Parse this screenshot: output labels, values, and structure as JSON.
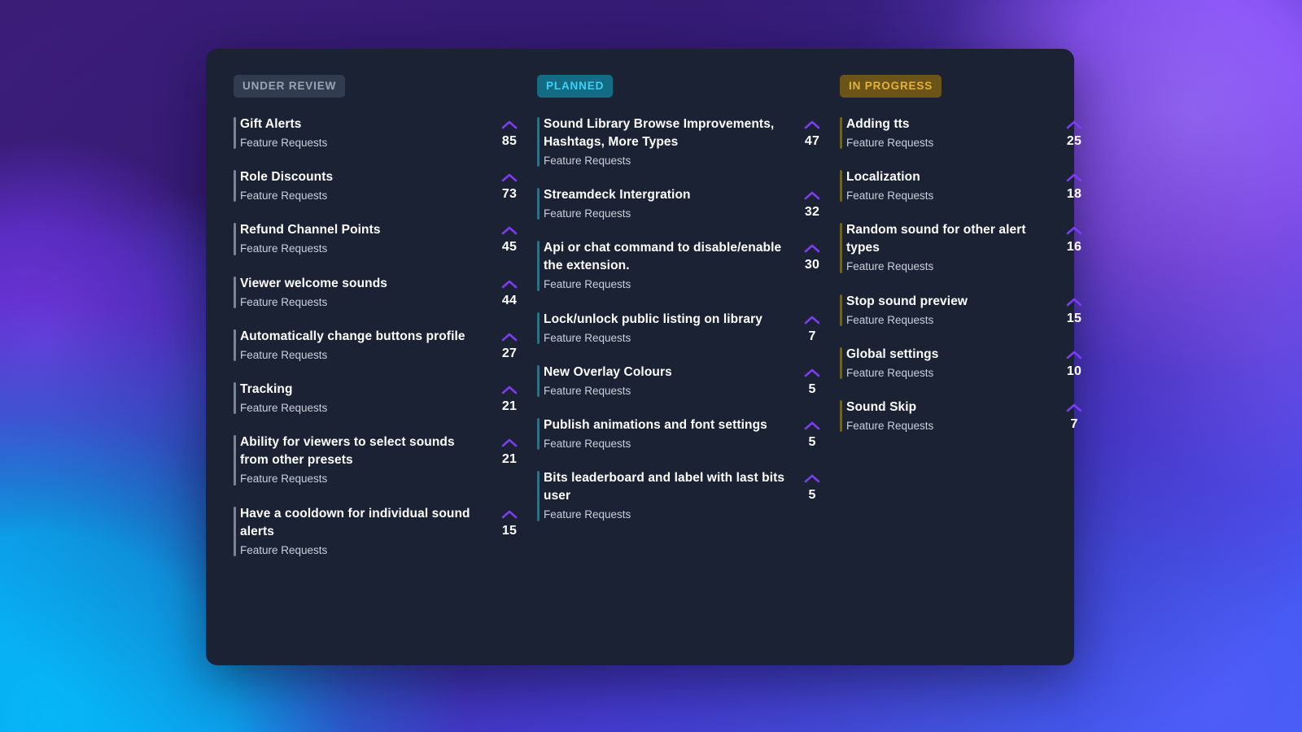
{
  "theme": {
    "panel_bg": "#1b2233",
    "card_title_color": "#ffffff",
    "card_sub_color": "#c9cfdb",
    "vote_arrow_color": "#7c3df0",
    "accent_under_review": "#7b8494",
    "accent_planned": "#2e6f86",
    "accent_in_progress": "#6d6323"
  },
  "columns": [
    {
      "id": "under-review",
      "label": "UNDER REVIEW",
      "badge_bg": "#323c50",
      "badge_fg": "#9aa4b4",
      "cards": [
        {
          "title": "Gift Alerts",
          "board": "Feature Requests",
          "votes": "85"
        },
        {
          "title": "Role Discounts",
          "board": "Feature Requests",
          "votes": "73"
        },
        {
          "title": "Refund Channel Points",
          "board": "Feature Requests",
          "votes": "45"
        },
        {
          "title": "Viewer welcome sounds",
          "board": "Feature Requests",
          "votes": "44"
        },
        {
          "title": "Automatically change buttons profile",
          "board": "Feature Requests",
          "votes": "27"
        },
        {
          "title": "Tracking",
          "board": "Feature Requests",
          "votes": "21"
        },
        {
          "title": "Ability for viewers to select sounds from other presets",
          "board": "Feature Requests",
          "votes": "21"
        },
        {
          "title": "Have a cooldown for individual sound alerts",
          "board": "Feature Requests",
          "votes": "15"
        }
      ]
    },
    {
      "id": "planned",
      "label": "PLANNED",
      "badge_bg": "#136b84",
      "badge_fg": "#3fd0f5",
      "cards": [
        {
          "title": "Sound Library Browse Improvements, Hashtags, More Types",
          "board": "Feature Requests",
          "votes": "47"
        },
        {
          "title": "Streamdeck Intergration",
          "board": "Feature Requests",
          "votes": "32"
        },
        {
          "title": "Api or chat command to disable/enable the extension.",
          "board": "Feature Requests",
          "votes": "30"
        },
        {
          "title": "Lock/unlock public listing on library",
          "board": "Feature Requests",
          "votes": "7"
        },
        {
          "title": "New Overlay Colours",
          "board": "Feature Requests",
          "votes": "5"
        },
        {
          "title": "Publish animations and font settings",
          "board": "Feature Requests",
          "votes": "5"
        },
        {
          "title": "Bits leaderboard and label with last bits user",
          "board": "Feature Requests",
          "votes": "5"
        }
      ]
    },
    {
      "id": "in-progress",
      "label": "IN PROGRESS",
      "badge_bg": "#6a5417",
      "badge_fg": "#e3b23c",
      "cards": [
        {
          "title": "Adding tts",
          "board": "Feature Requests",
          "votes": "25"
        },
        {
          "title": "Localization",
          "board": "Feature Requests",
          "votes": "18"
        },
        {
          "title": "Random sound for other alert types",
          "board": "Feature Requests",
          "votes": "16"
        },
        {
          "title": "Stop sound preview",
          "board": "Feature Requests",
          "votes": "15"
        },
        {
          "title": "Global settings",
          "board": "Feature Requests",
          "votes": "10"
        },
        {
          "title": "Sound Skip",
          "board": "Feature Requests",
          "votes": "7"
        }
      ]
    }
  ]
}
